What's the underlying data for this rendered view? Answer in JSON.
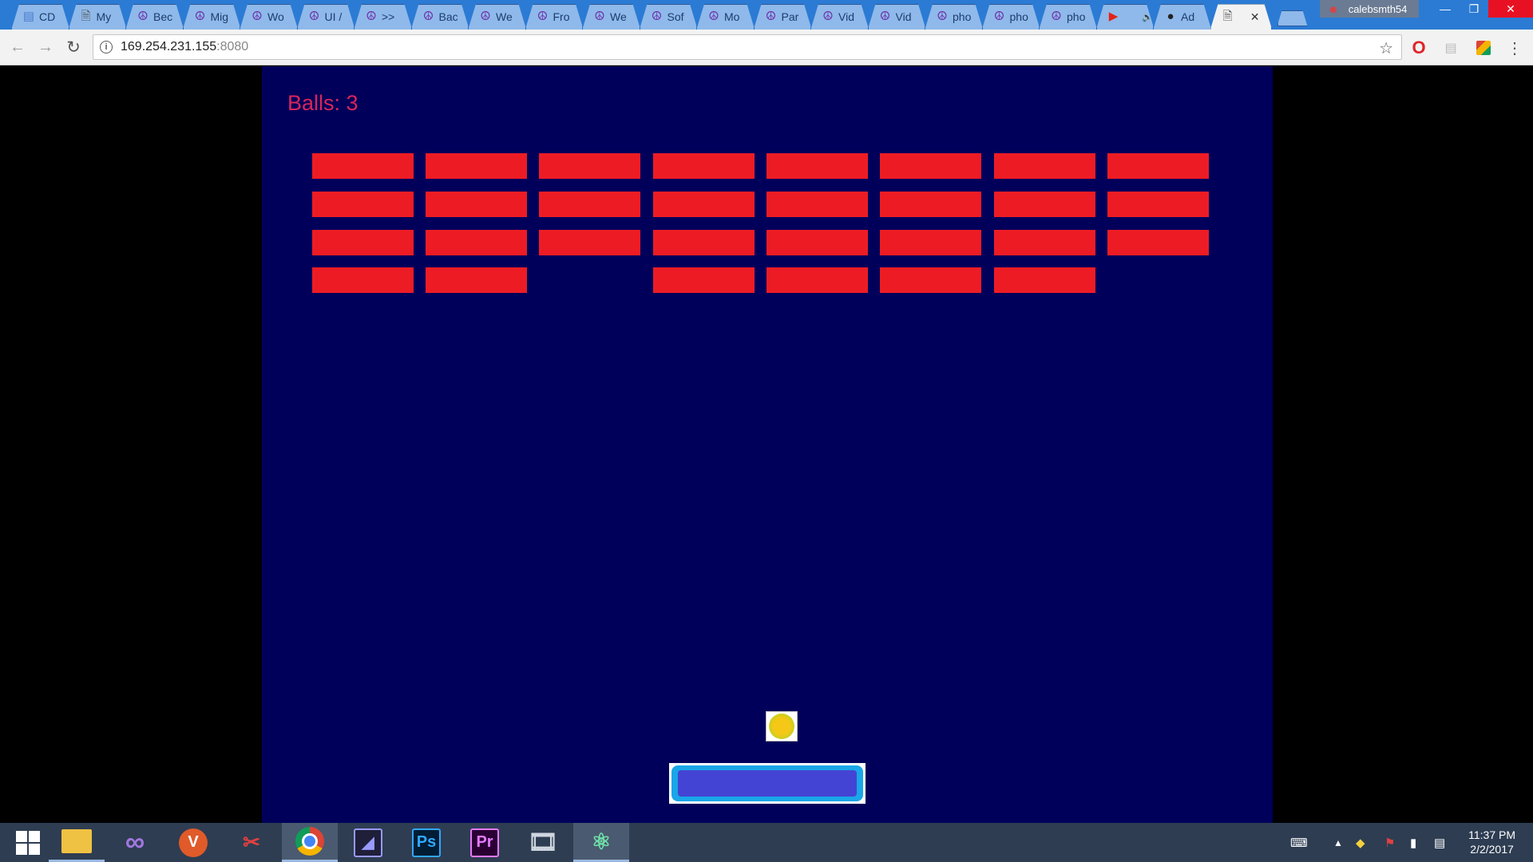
{
  "browser": {
    "tabs": [
      {
        "favicon": "docs-icon",
        "title": "CD"
      },
      {
        "favicon": "page-icon",
        "title": "My"
      },
      {
        "favicon": "peace-icon",
        "title": "Bec"
      },
      {
        "favicon": "peace-icon",
        "title": "Mig"
      },
      {
        "favicon": "peace-icon",
        "title": "Wo"
      },
      {
        "favicon": "peace-icon",
        "title": "UI /"
      },
      {
        "favicon": "peace-icon",
        "title": ">>"
      },
      {
        "favicon": "peace-icon",
        "title": "Bac"
      },
      {
        "favicon": "peace-icon",
        "title": "We"
      },
      {
        "favicon": "peace-icon",
        "title": "Fro"
      },
      {
        "favicon": "peace-icon",
        "title": "We"
      },
      {
        "favicon": "peace-icon",
        "title": "Sof"
      },
      {
        "favicon": "peace-icon",
        "title": "Mo"
      },
      {
        "favicon": "peace-icon",
        "title": "Par"
      },
      {
        "favicon": "peace-icon",
        "title": "Vid"
      },
      {
        "favicon": "peace-icon",
        "title": "Vid"
      },
      {
        "favicon": "peace-icon",
        "title": "pho"
      },
      {
        "favicon": "peace-icon",
        "title": "pho"
      },
      {
        "favicon": "peace-icon",
        "title": "pho"
      },
      {
        "favicon": "youtube-icon",
        "title": ""
      },
      {
        "favicon": "github-icon",
        "title": "Ad"
      },
      {
        "favicon": "page-icon",
        "title": "",
        "active": true
      }
    ],
    "user": "calebsmth54",
    "url_host": "169.254.231.155",
    "url_port": ":8080"
  },
  "game": {
    "balls_label": "Balls: 3",
    "colors": {
      "background": "#00005a",
      "brick": "#ed1c24",
      "paddle": "#4444d4",
      "paddle_border": "#1aa6e8",
      "ball": "#f5c817",
      "score_text": "#d9255a"
    },
    "bricks": [
      [
        1,
        1,
        1,
        1,
        1,
        1,
        1,
        1
      ],
      [
        1,
        1,
        1,
        1,
        1,
        1,
        1,
        1
      ],
      [
        1,
        1,
        1,
        1,
        1,
        1,
        1,
        1
      ],
      [
        1,
        1,
        0,
        1,
        1,
        1,
        1,
        0
      ]
    ]
  },
  "taskbar": {
    "apps": [
      "start-icon",
      "file-explorer-icon",
      "visual-studio-icon",
      "vivaldi-icon",
      "snipping-tool-icon",
      "chrome-icon",
      "media-encoder-icon",
      "photoshop-icon",
      "premiere-icon",
      "film-icon",
      "atom-icon"
    ],
    "ps_label": "Ps",
    "pr_label": "Pr",
    "time": "11:37 PM",
    "date": "2/2/2017"
  }
}
